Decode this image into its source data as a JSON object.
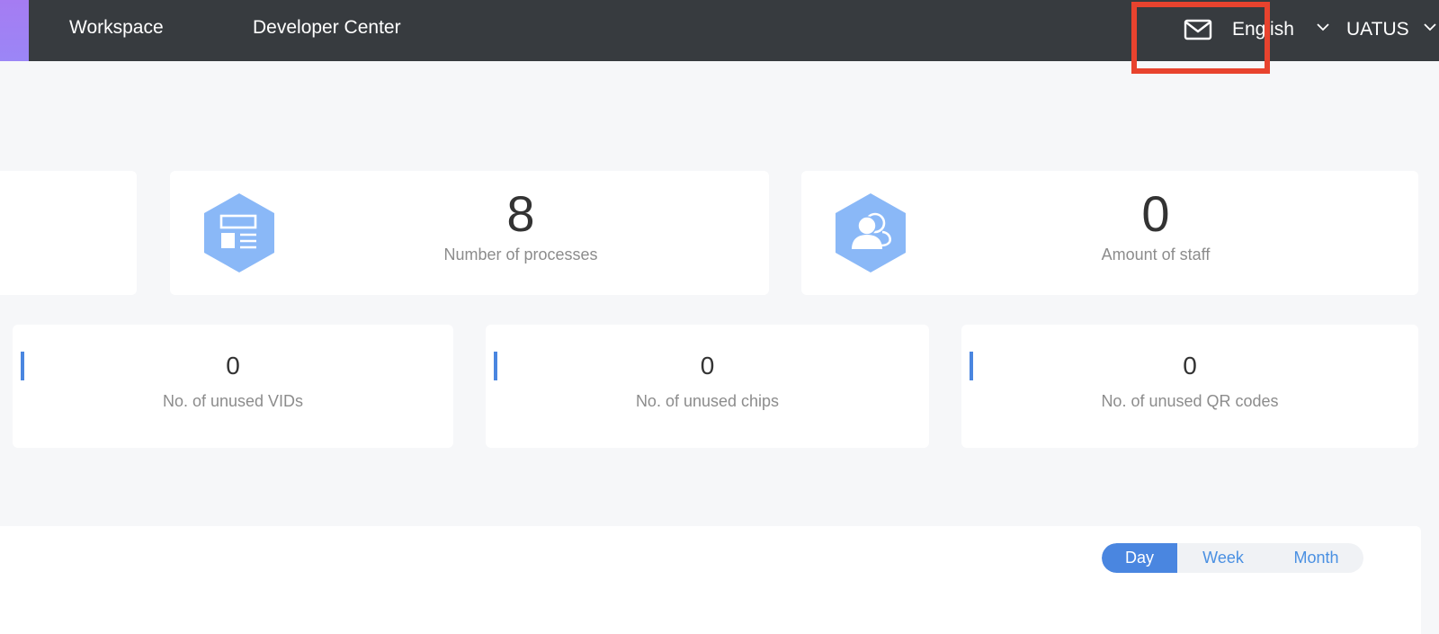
{
  "topbar": {
    "nav": [
      {
        "label": "Workspace"
      },
      {
        "label": "Developer Center"
      }
    ],
    "mail_icon": "mail-icon",
    "language": {
      "label": "English",
      "icon": "chevron-down-icon"
    },
    "user": {
      "label": "UATUS",
      "icon": "chevron-down-icon"
    },
    "highlight_color": "#e8432e"
  },
  "stats_primary": [
    {
      "value": "8",
      "label": "Number of processes",
      "icon": "form-list-icon"
    },
    {
      "value": "0",
      "label": "Amount of staff",
      "icon": "staff-users-icon"
    }
  ],
  "stats_secondary": [
    {
      "value": "0",
      "label": "No. of unused VIDs"
    },
    {
      "value": "0",
      "label": "No. of unused chips"
    },
    {
      "value": "0",
      "label": "No. of unused QR codes"
    }
  ],
  "period_toggle": {
    "options": [
      "Day",
      "Week",
      "Month"
    ],
    "selected": "Day"
  },
  "colors": {
    "topbar_bg": "#373b3f",
    "brand_accent": "#a57cf2",
    "icon_blue": "#8ab8f7",
    "accent_blue": "#4a86e0",
    "page_bg": "#f6f7f9"
  }
}
